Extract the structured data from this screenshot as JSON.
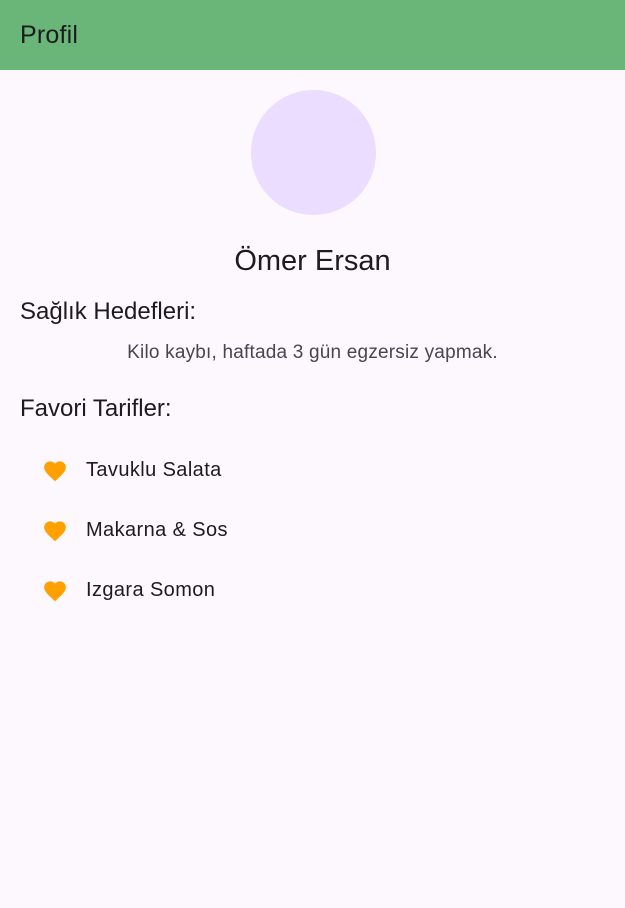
{
  "app_bar": {
    "title": "Profil"
  },
  "profile": {
    "name": "Ömer Ersan"
  },
  "health_goals": {
    "heading": "Sağlık Hedefleri:",
    "text": "Kilo kaybı, haftada 3 gün egzersiz yapmak."
  },
  "favorite_recipes": {
    "heading": "Favori Tarifler:",
    "items": [
      {
        "label": "Tavuklu Salata",
        "icon": "heart-icon"
      },
      {
        "label": "Makarna & Sos",
        "icon": "heart-icon"
      },
      {
        "label": "Izgara Somon",
        "icon": "heart-icon"
      }
    ]
  },
  "colors": {
    "app_bar": "#69b678",
    "background": "#fdf7fe",
    "avatar": "#eaddff",
    "heart": "#ffa000"
  }
}
